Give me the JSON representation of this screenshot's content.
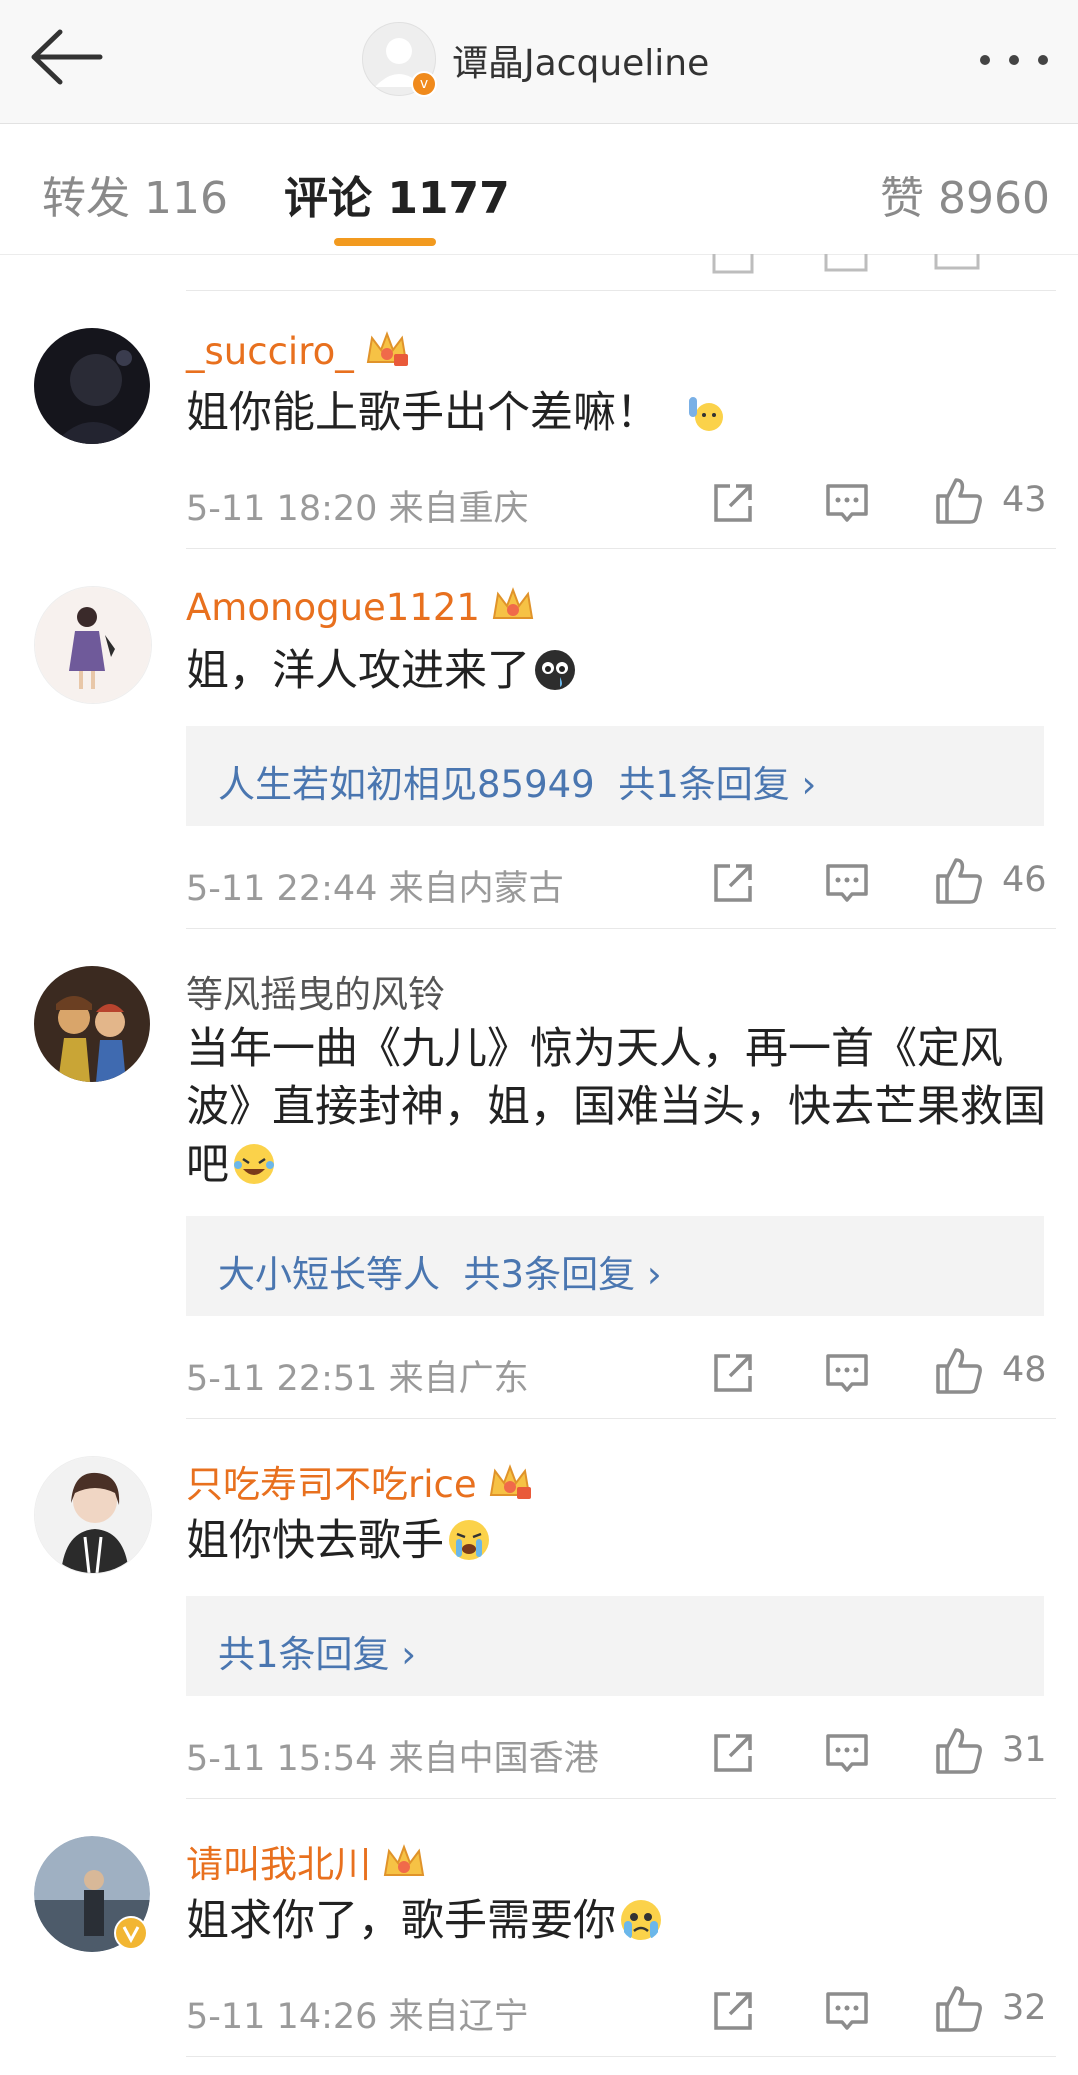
{
  "header": {
    "title": "谭晶Jacqueline",
    "back_icon": "back-arrow-icon",
    "more_icon": "more-dots-icon"
  },
  "tabs": [
    {
      "label": "转发 116",
      "active": false
    },
    {
      "label": "评论 1177",
      "active": true
    },
    {
      "label": "赞 8960",
      "active": false
    }
  ],
  "colors": {
    "accent": "#f29a1f",
    "username": "#e8701e",
    "reply_link": "#4a76b0",
    "meta": "#9a9a9a"
  },
  "comments": [
    {
      "username": "_succiro_",
      "vip_crown": true,
      "text": "姐你能上歌手出个差嘛！",
      "emoji": "raising-hand-emoji",
      "reply": null,
      "time": "5-11 18:20",
      "location": "来自重庆",
      "likes": "43"
    },
    {
      "username": "Amonogue1121",
      "vip_crown": true,
      "text": "姐，洋人攻进来了",
      "emoji": "crying-face-emoji",
      "reply": {
        "user": "人生若如初相见85949",
        "count": "共1条回复 ›"
      },
      "time": "5-11 22:44",
      "location": "来自内蒙古",
      "likes": "46"
    },
    {
      "username": "等风摇曳的风铃",
      "vip_crown": false,
      "text": "当年一曲《九儿》惊为天人，再一首《定风波》直接封神，姐，国难当头，快去芒果救国吧",
      "emoji": "laughing-tears-emoji",
      "reply": {
        "user": "大小短长等人",
        "count": "共3条回复 ›"
      },
      "time": "5-11 22:51",
      "location": "来自广东",
      "likes": "48"
    },
    {
      "username": "只吃寿司不吃rice",
      "vip_crown": true,
      "text": "姐你快去歌手",
      "emoji": "loudly-crying-emoji",
      "reply": {
        "user": "",
        "count": "共1条回复 ›"
      },
      "time": "5-11 15:54",
      "location": "来自中国香港",
      "likes": "31"
    },
    {
      "username": "请叫我北川",
      "vip_crown": true,
      "text": "姐求你了，歌手需要你",
      "emoji": "pleading-crying-emoji",
      "reply": null,
      "time": "5-11 14:26",
      "location": "来自辽宁",
      "likes": "32"
    }
  ],
  "actions": {
    "share_icon": "share-icon",
    "comment_icon": "comment-icon",
    "like_icon": "thumbs-up-icon"
  }
}
